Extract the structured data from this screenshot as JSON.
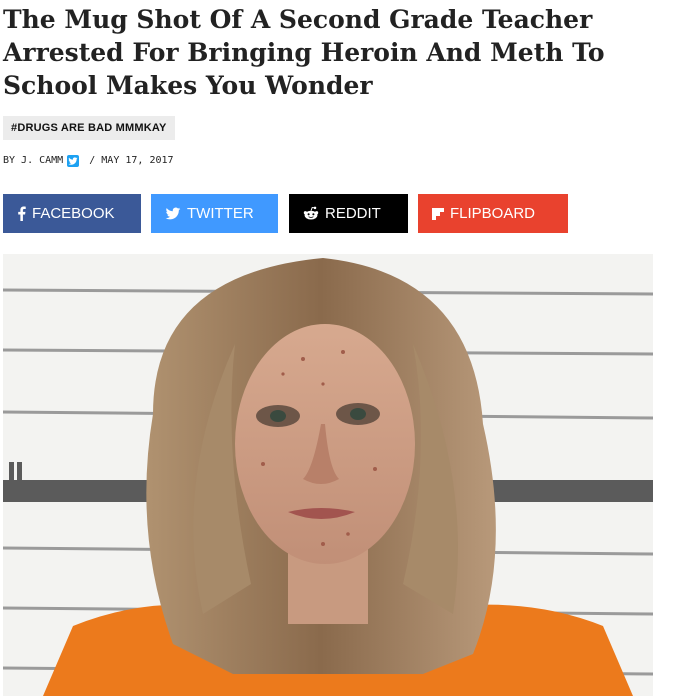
{
  "article": {
    "title": "The Mug Shot Of A Second Grade Teacher Arrested For Bringing Heroin And Meth To School Makes You Wonder",
    "tag": "#DRUGS ARE BAD MMMKAY",
    "byline": {
      "prefix": "BY J. CAMM",
      "separator": " / ",
      "date": "MAY 17, 2017"
    }
  },
  "share_buttons": {
    "facebook": "FACEBOOK",
    "twitter": "TWITTER",
    "reddit": "REDDIT",
    "flipboard": "FLIPBOARD"
  },
  "colors": {
    "facebook": "#3b5998",
    "twitter": "#4099ff",
    "reddit": "#000000",
    "flipboard": "#e9422e",
    "tag_bg": "#ececec"
  },
  "icons": [
    "facebook-icon",
    "twitter-icon",
    "reddit-icon",
    "flipboard-icon",
    "twitter-mini-icon"
  ]
}
